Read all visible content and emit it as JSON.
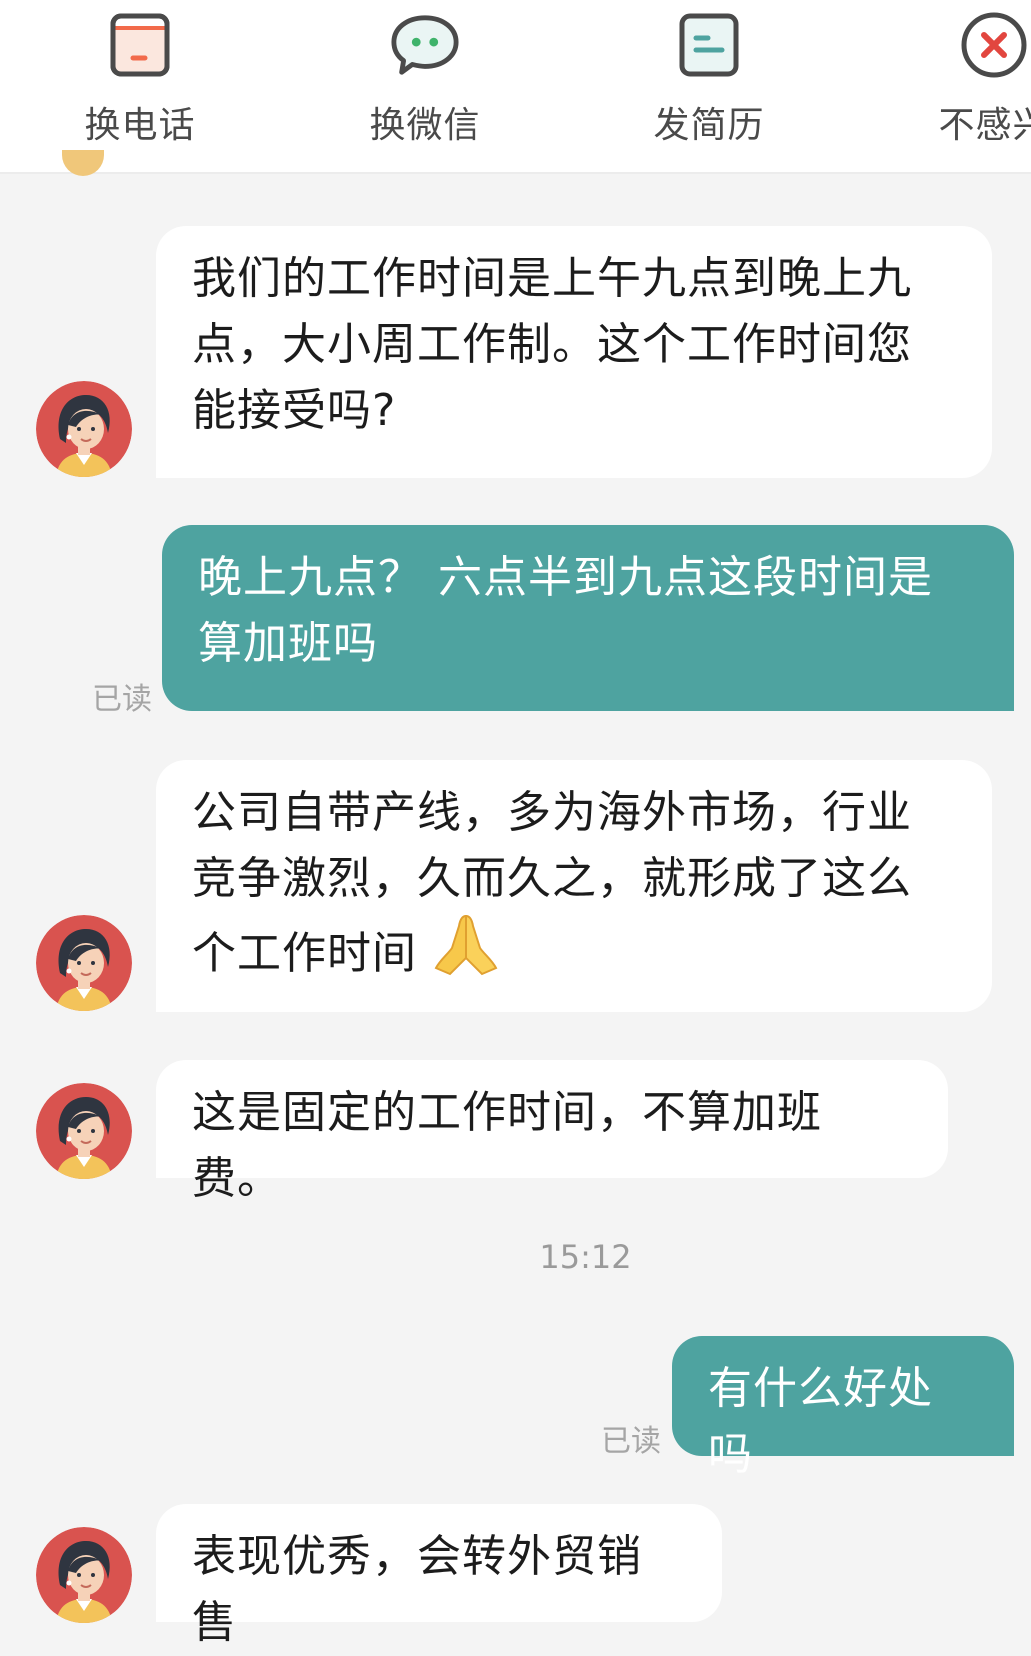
{
  "action_bar": {
    "items": [
      {
        "label": "换电话",
        "icon": "phone-card-icon"
      },
      {
        "label": "换微信",
        "icon": "wechat-bubble-icon"
      },
      {
        "label": "发简历",
        "icon": "resume-icon"
      },
      {
        "label": "不感兴",
        "icon": "close-circle-icon"
      }
    ]
  },
  "colors": {
    "accent": "#4ea3a0",
    "incoming_bubble": "#ffffff",
    "background": "#f4f4f4",
    "icon_red": "#e2463f",
    "icon_orange": "#f28a3a",
    "icon_green": "#4ea3a0"
  },
  "messages": [
    {
      "from": "recruiter",
      "text": "我们的工作时间是上午九点到晚上九点，大小周工作制。这个工作时间您能接受吗?"
    },
    {
      "from": "me",
      "text": "晚上九点？ 六点半到九点这段时间是算加班吗",
      "status": "已读"
    },
    {
      "from": "recruiter",
      "text": "公司自带产线，多为海外市场，行业竞争激烈，久而久之，就形成了这么个工作时间",
      "emoji": "folded-hands-icon"
    },
    {
      "from": "recruiter",
      "text": "这是固定的工作时间，不算加班费。"
    },
    {
      "from": "me",
      "text": "有什么好处吗",
      "status": "已读"
    },
    {
      "from": "recruiter",
      "text": "表现优秀，会转外贸销售"
    }
  ],
  "timestamp": "15:12"
}
